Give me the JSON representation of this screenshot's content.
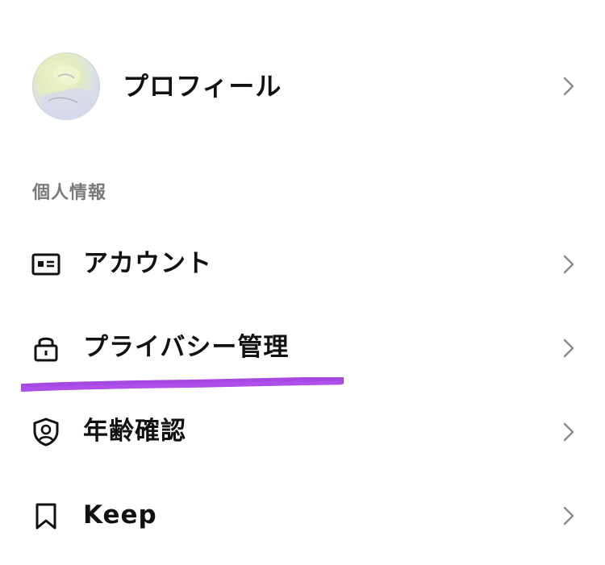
{
  "profile": {
    "name": "プロフィール"
  },
  "section": {
    "title": "個人情報"
  },
  "menu": {
    "items": [
      {
        "label": "アカウント",
        "icon": "id-card-icon"
      },
      {
        "label": "プライバシー管理",
        "icon": "lock-icon"
      },
      {
        "label": "年齢確認",
        "icon": "shield-person-icon"
      },
      {
        "label": "Keep",
        "icon": "bookmark-icon"
      }
    ]
  },
  "colors": {
    "text": "#111111",
    "section_text": "#7a7a7a",
    "chevron": "#8a8a8a",
    "highlight": "#a13ee0"
  }
}
